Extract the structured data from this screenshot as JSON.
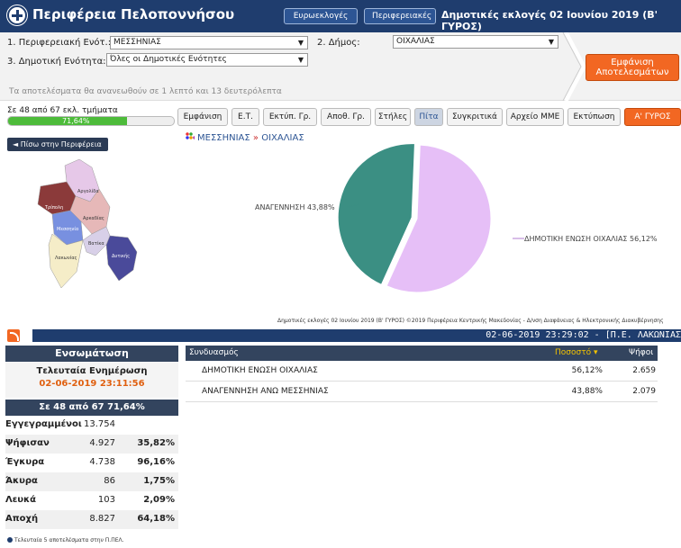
{
  "header": {
    "title": "Περιφέρεια Πελοποννήσου",
    "btn_euro": "Ευρωεκλογές",
    "btn_region": "Περιφερειακές",
    "election_title": "Δημοτικές εκλογές 02 Ιουνίου 2019 (Β' ΓΥΡΟΣ)"
  },
  "selectors": {
    "region_label": "1. Περιφερειακή Ενότ.:",
    "region_value": "ΜΕΣΣΗΝΙΑΣ",
    "municipality_label": "2. Δήμος:",
    "municipality_value": "ΟΙΧΑΛΙΑΣ",
    "unit_label": "3. Δημοτική Ενότητα:",
    "unit_value": "Όλες οι Δημοτικές Ενότητες",
    "update_note": "Τα αποτελέσματα θα ανανεωθούν σε 1 λεπτό και 13 δευτερόλεπτα",
    "show_results": "Εμφάνιση Αποτελεσμάτων"
  },
  "progress": {
    "text": "Σε 48 από 67 εκλ. τμήματα",
    "pct_label": "71,64%",
    "fraction": 0.7164
  },
  "tabs": [
    "Εμφάνιση",
    "Ε.Τ.",
    "Εκτύπ. Γρ.",
    "Αποθ. Γρ.",
    "Στήλες",
    "Πίτα",
    "Συγκριτικά",
    "Αρχείο ΜΜΕ",
    "Εκτύπωση",
    "Α' ΓΥΡΟΣ"
  ],
  "back_button": "◄ Πίσω στην Περιφέρεια",
  "breadcrumb": {
    "region": "ΜΕΣΣΗΝΙΑΣ",
    "sep": "»",
    "municipality": "ΟΙΧΑΛΙΑΣ"
  },
  "map": {
    "labels": [
      "Αργολίδα",
      "Τρίπολη",
      "Αρκαδίας",
      "Μεσσηνία",
      "Λακωνίας",
      "Δυτικής",
      "Βατίκα"
    ]
  },
  "chart_data": {
    "type": "pie",
    "slices": [
      {
        "label": "ΔΗΜΟΤΙΚΗ ΕΝΩΣΗ ΟΙΧΑΛΙΑΣ 56,12%",
        "value": 56.12,
        "color": "#e6bff7"
      },
      {
        "label": "ΑΝΑΓΕΝΝΗΣΗ 43,88%",
        "value": 43.88,
        "color": "#3b8f83"
      }
    ],
    "footer": "Δημοτικές εκλογές 02 Ιουνίου 2019 (Β' ΓΥΡΟΣ) ©2019 Περιφέρεια Κεντρικής Μακεδονίας - Δ/νση Διαφάνειας & Ηλεκτρονικής Διακυβέρνησης"
  },
  "ticker": "02-06-2019 23:29:02 - [Π.Ε. ΛΑΚΩΝΙΑΣ",
  "left_panel": {
    "integration": "Ενσωμάτωση",
    "last_update_label": "Τελευταία Ενημέρωση",
    "last_update_value": "02-06-2019 23:11:56",
    "counted": "Σε 48 από 67   71,64%",
    "stats": [
      {
        "label": "Εγγεγραμμένοι",
        "value": "13.754",
        "pct": ""
      },
      {
        "label": "Ψήφισαν",
        "value": "4.927",
        "pct": "35,82%"
      },
      {
        "label": "Έγκυρα",
        "value": "4.738",
        "pct": "96,16%"
      },
      {
        "label": "Άκυρα",
        "value": "86",
        "pct": "1,75%"
      },
      {
        "label": "Λευκά",
        "value": "103",
        "pct": "2,09%"
      },
      {
        "label": "Αποχή",
        "value": "8.827",
        "pct": "64,18%"
      }
    ]
  },
  "results": {
    "col_combination": "Συνδυασμός",
    "col_percent": "Ποσοστό",
    "col_votes": "Ψήφοι",
    "rows": [
      {
        "name": "ΔΗΜΟΤΙΚΗ ΕΝΩΣΗ ΟΙΧΑΛΙΑΣ",
        "pct": "56,12%",
        "votes": "2.659"
      },
      {
        "name": "ΑΝΑΓΕΝΝΗΣΗ ΑΝΩ ΜΕΣΣΗΝΙΑΣ",
        "pct": "43,88%",
        "votes": "2.079"
      }
    ]
  },
  "footnote": "Τελευταία 5 αποτελέσματα στην Π.ΠΕΛ."
}
